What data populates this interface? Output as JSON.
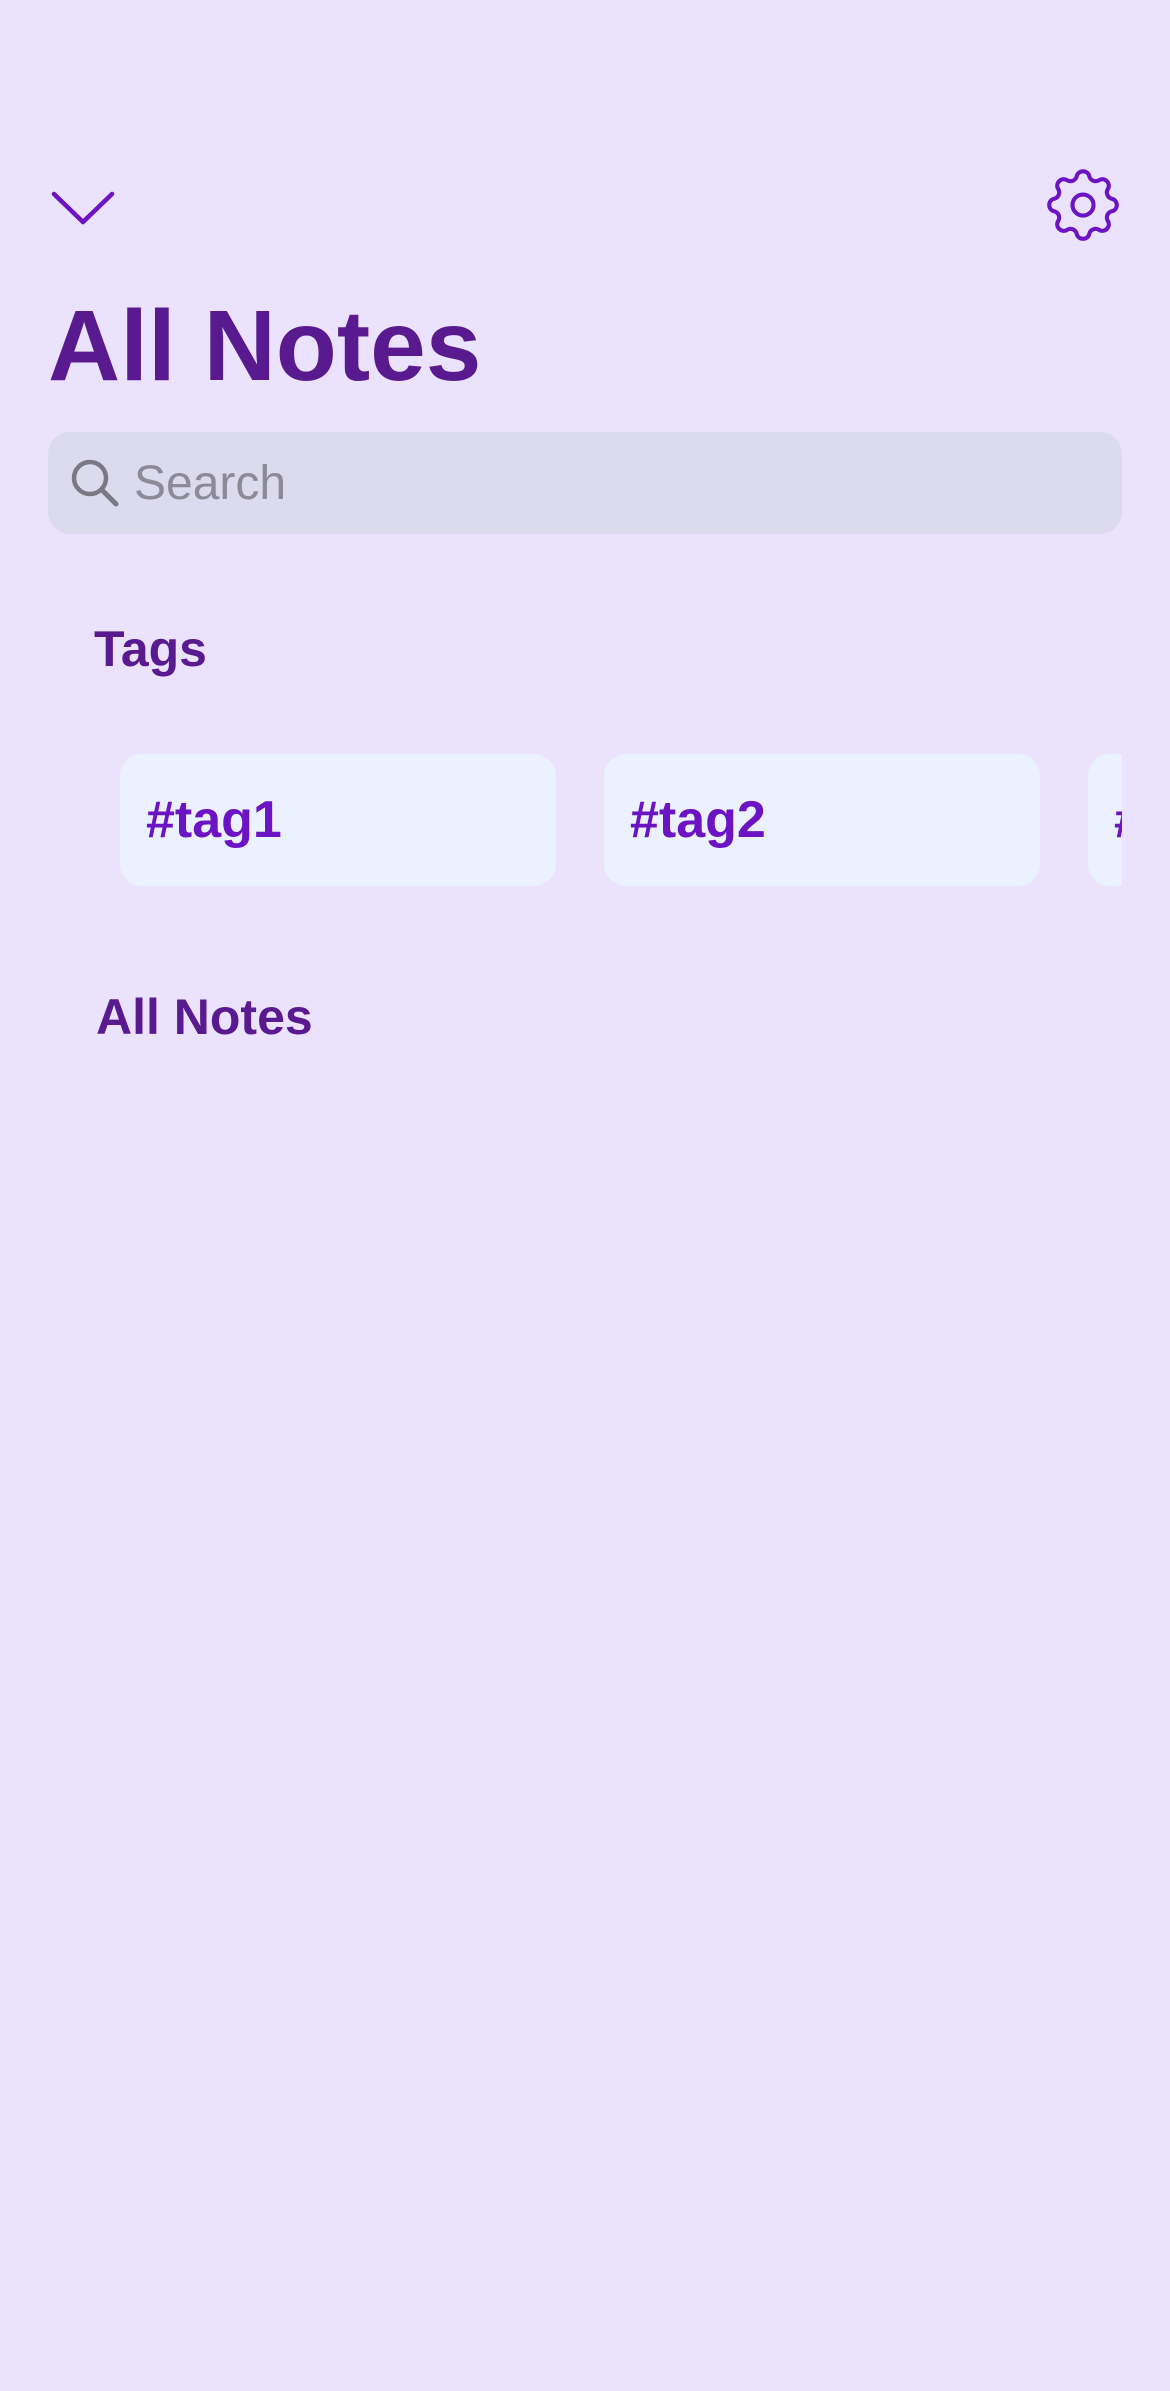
{
  "header": {
    "title": "All Notes",
    "collapse_icon": "chevron-down-icon",
    "settings_icon": "gear-icon"
  },
  "search": {
    "placeholder": "Search",
    "value": "",
    "icon": "search-icon"
  },
  "tags_section": {
    "title": "Tags",
    "tags": [
      {
        "label": "#tag1"
      },
      {
        "label": "#tag2"
      },
      {
        "label": "#"
      }
    ]
  },
  "notes_section": {
    "title": "All Notes",
    "notes": []
  },
  "colors": {
    "background": "#ebe2fe",
    "title": "#5a1a8f",
    "accent": "#6c14c4",
    "search_bg": "#dcdbee",
    "tag_bg": "#ebf1fe",
    "placeholder": "#8c8a96"
  }
}
